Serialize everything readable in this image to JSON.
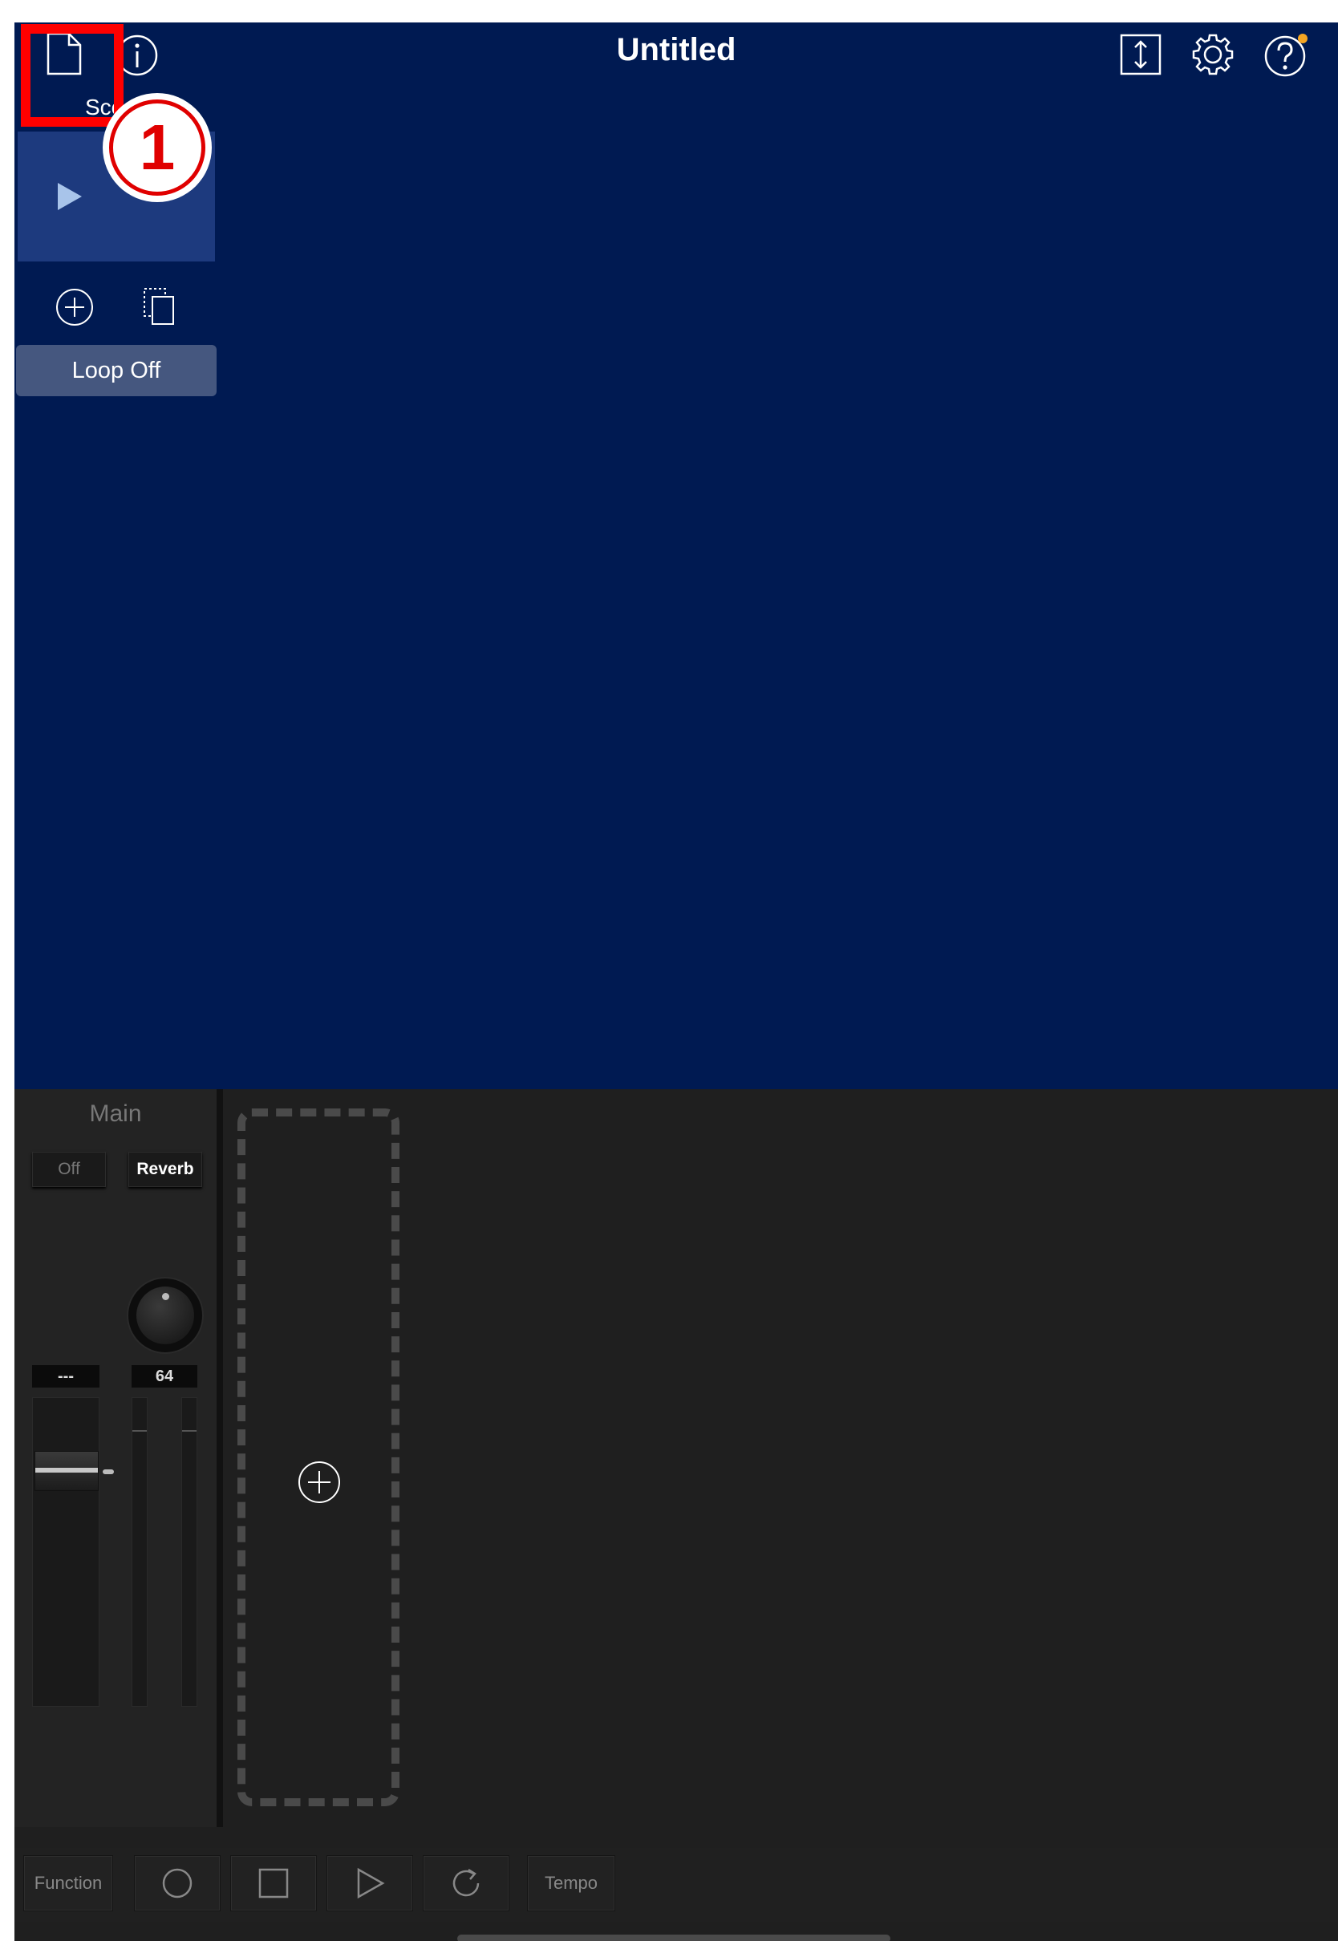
{
  "header": {
    "title": "Untitled",
    "icons": [
      "new-file-icon",
      "info-icon",
      "resize-icon",
      "settings-icon",
      "help-icon"
    ],
    "accent_dot_color": "#f5a623"
  },
  "scenes": {
    "label": "Sce",
    "loop_label": "Loop Off",
    "badge_text": "1"
  },
  "mixer": {
    "channel_name": "Main",
    "off_label": "Off",
    "reverb_label": "Reverb",
    "left_value": "---",
    "knob_value": "64"
  },
  "transport": {
    "function_label": "Function",
    "tempo_label": "Tempo"
  },
  "colors": {
    "top_bg": "#001a52",
    "bottom_bg": "#1f1f1f",
    "highlight": "#ff0000"
  }
}
